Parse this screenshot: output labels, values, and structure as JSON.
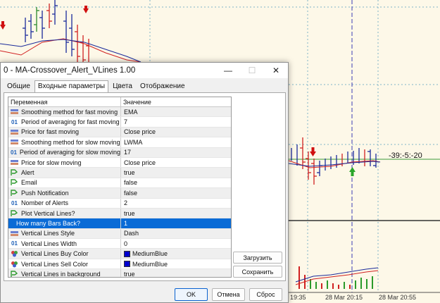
{
  "dialog": {
    "title": "0 - MA-Crossover_Alert_VLines 1.00",
    "tabs": [
      "Общие",
      "Входные параметры",
      "Цвета",
      "Отображение"
    ],
    "header": {
      "col1": "Переменная",
      "col2": "Значение"
    },
    "rows": [
      {
        "icon": "ma-method",
        "name": "Smoothing method for fast moving",
        "value": "EMA"
      },
      {
        "icon": "int",
        "name": "Period of averaging for fast moving",
        "value": "7"
      },
      {
        "icon": "ma-method",
        "name": "Price for fast moving",
        "value": "Close price"
      },
      {
        "icon": "ma-method",
        "name": "Smoothing method for slow moving",
        "value": "LWMA"
      },
      {
        "icon": "int",
        "name": "Period of averaging for slow moving",
        "value": "17"
      },
      {
        "icon": "ma-method",
        "name": "Price for slow moving",
        "value": "Close price"
      },
      {
        "icon": "bool",
        "name": "Alert",
        "value": "true"
      },
      {
        "icon": "bool",
        "name": "Email",
        "value": "false"
      },
      {
        "icon": "bool",
        "name": "Push Notification",
        "value": "false"
      },
      {
        "icon": "int",
        "name": "Nomber of Alerts",
        "value": "2"
      },
      {
        "icon": "bool",
        "name": "Plot Vertical Lines?",
        "value": "true"
      },
      {
        "icon": "int",
        "name": "How many Bars Back?",
        "value": "1",
        "selected": true
      },
      {
        "icon": "ma-method",
        "name": "Vertical Lines Style",
        "value": "Dash"
      },
      {
        "icon": "int",
        "name": "Vertical Lines Width",
        "value": "0"
      },
      {
        "icon": "color",
        "name": "Vertical Lines Buy Color",
        "value": "MediumBlue",
        "swatch": "#0000cd"
      },
      {
        "icon": "color",
        "name": "Vertical Lines Sell Color",
        "value": "MediumBlue",
        "swatch": "#0000cd"
      },
      {
        "icon": "bool",
        "name": "Vertical Lines in background",
        "value": "true"
      }
    ],
    "load_label": "Загрузить",
    "save_label": "Сохранить",
    "ok_label": "OK",
    "cancel_label": "Отмена",
    "reset_label": "Сброс"
  },
  "chart": {
    "countdown": "-39:-5:-20",
    "time_labels": [
      "19:35",
      "28 Mar 20:15",
      "28 Mar 20:55"
    ]
  },
  "colors": {
    "accent": "#0a6bd6",
    "swatch": "#0000cd",
    "chart_bg": "#fdf8e8"
  }
}
